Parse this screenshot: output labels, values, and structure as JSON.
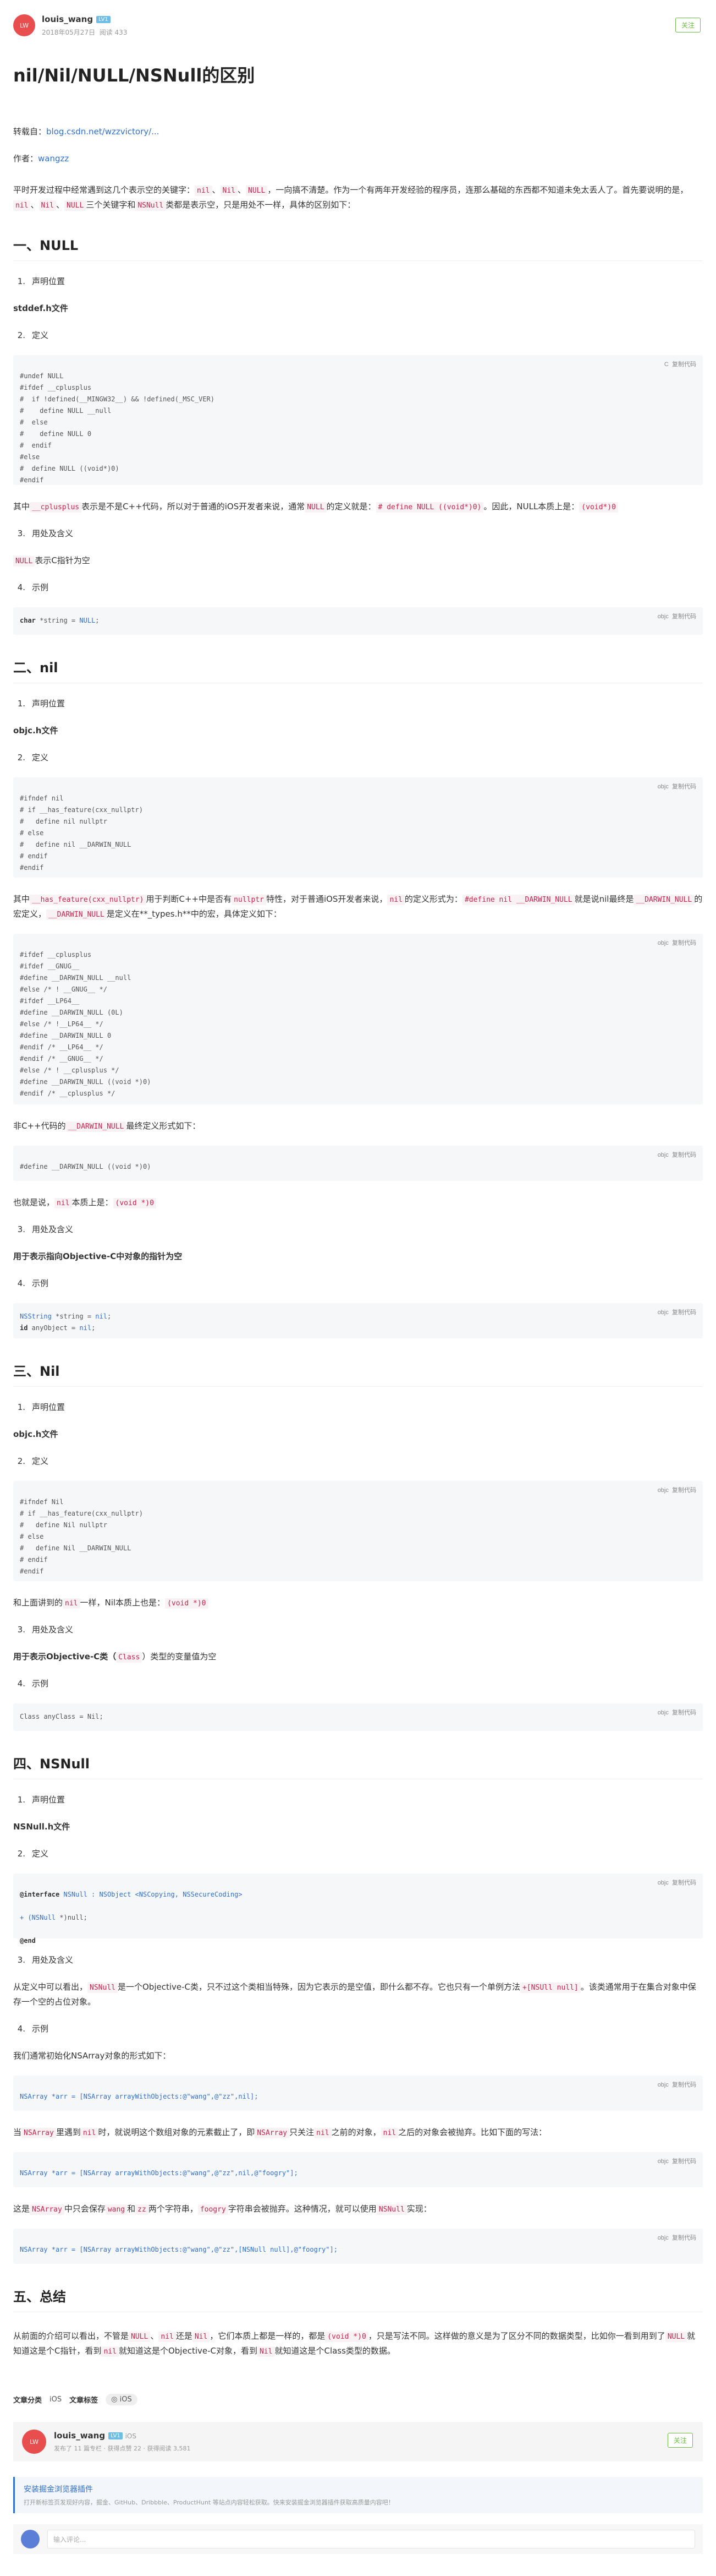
{
  "author": {
    "name": "louis_wang",
    "level": "LV1",
    "date": "2018年05月27日",
    "views": "阅读 433",
    "avatar_text": "LW",
    "follow_label": "关注"
  },
  "article": {
    "title": "nil/Nil/NULL/NSNull的区别",
    "reprint_label": "转载自：",
    "reprint_link": "blog.csdn.net/wzzvictory/...",
    "author_label": "作者：",
    "author_link": "wangzz",
    "intro_1": "平时开发过程中经常遇到这几个表示空的关键字：",
    "intro_kw": [
      "nil",
      "Nil",
      "NULL"
    ],
    "intro_2": "，一向搞不清楚。作为一个有两年开发经验的程序员，连那么基础的东西都不知道未免太丢人了。首先要说明的是，",
    "intro_kw2": [
      "nil",
      "Nil",
      "NULL"
    ],
    "intro_3": "三个关键字和",
    "intro_kw3": "NSNull",
    "intro_4": "类都是表示空，只是用处不一样，具体的区别如下："
  },
  "copy_label": "复制代码",
  "lang_c": "C",
  "lang_objc": "objc",
  "sections": {
    "null": {
      "heading": "一、NULL",
      "s1": "声明位置",
      "file": "stddef.h文件",
      "s2": "定义",
      "code": "#undef NULL\n#ifdef __cplusplus\n#  if !defined(__MINGW32__) && !defined(_MSC_VER)\n#    define NULL __null\n#  else\n#    define NULL 0\n#  endif\n#else\n#  define NULL ((void*)0)\n#endif",
      "p1a": "其中",
      "p1k1": "__cplusplus",
      "p1b": "表示是不是C++代码，所以对于普通的iOS开发者来说，通常",
      "p1k2": "NULL",
      "p1c": "的定义就是：",
      "p1k3": "# define NULL ((void*)0)",
      "p1d": "。因此，NULL本质上是：",
      "p1k4": "(void*)0",
      "s3": "用处及含义",
      "p2k": "NULL",
      "p2": "表示C指针为空",
      "s4": "示例",
      "ex_kw": "char",
      "ex_rest": " *string = ",
      "ex_val": "NULL",
      "ex_end": ";"
    },
    "nil": {
      "heading": "二、nil",
      "s1": "声明位置",
      "file": "objc.h文件",
      "s2": "定义",
      "code": "#ifndef nil\n# if __has_feature(cxx_nullptr)\n#   define nil nullptr\n# else\n#   define nil __DARWIN_NULL\n# endif\n#endif",
      "p1a": "其中",
      "p1k1": "__has_feature(cxx_nullptr)",
      "p1b": "用于判断C++中是否有",
      "p1k2": "nullptr",
      "p1c": "特性，对于普通iOS开发者来说，",
      "p1k3": "nil",
      "p1d": "的定义形式为：",
      "p1k4": "#define nil __DARWIN_NULL",
      "p1e": "就是说nil最终是",
      "p1k5": "__DARWIN_NULL",
      "p1f": "的宏定义，",
      "p1k6": "__DARWIN_NULL",
      "p1g": "是定义在**_types.h**中的宏，具体定义如下：",
      "code2": "#ifdef __cplusplus\n#ifdef __GNUG__\n#define __DARWIN_NULL __null\n#else /* ! __GNUG__ */\n#ifdef __LP64__\n#define __DARWIN_NULL (0L)\n#else /* !__LP64__ */\n#define __DARWIN_NULL 0\n#endif /* __LP64__ */\n#endif /* __GNUG__ */\n#else /* ! __cplusplus */\n#define __DARWIN_NULL ((void *)0)\n#endif /* __cplusplus */",
      "p2a": "非C++代码的",
      "p2k": "__DARWIN_NULL",
      "p2b": "最终定义形式如下：",
      "code3": "#define __DARWIN_NULL ((void *)0)",
      "p3a": "也就是说，",
      "p3k1": "nil",
      "p3b": "本质上是：",
      "p3k2": "(void *)0",
      "s3": "用处及含义",
      "p4": "用于表示指向Objective-C中对象的指针为空",
      "s4": "示例",
      "ex1_ty": "NSString",
      "ex1_rest": " *string = ",
      "ex1_val": "nil",
      "ex2_kw": "id",
      "ex2_rest": " anyObject = ",
      "ex2_val": "nil"
    },
    "Nil": {
      "heading": "三、Nil",
      "s1": "声明位置",
      "file": "objc.h文件",
      "s2": "定义",
      "code": "#ifndef Nil\n# if __has_feature(cxx_nullptr)\n#   define Nil nullptr\n# else\n#   define Nil __DARWIN_NULL\n# endif\n#endif",
      "p1a": "和上面讲到的",
      "p1k1": "nil",
      "p1b": "一样，Nil本质上也是：",
      "p1k2": "(void *)0",
      "s3": "用处及含义",
      "p2a": "用于表示Objective-C类（",
      "p2k": "Class",
      "p2b": "）类型的变量值为空",
      "s4": "示例",
      "ex": "Class anyClass = Nil;"
    },
    "nsnull": {
      "heading": "四、NSNull",
      "s1": "声明位置",
      "file": "NSNull.h文件",
      "s2": "定义",
      "code_l1a": "@interface",
      "code_l1b": " NSNull : NSObject <NSCopying, NSSecureCoding>",
      "code_l2a": "+ (NSNull",
      "code_l2b": " *)null;",
      "code_l3": "@end",
      "s3": "用处及含义",
      "p1a": "从定义中可以看出，",
      "p1k1": "NSNull",
      "p1b": "是一个Objective-C类，只不过这个类相当特殊，因为它表示的是空值，即什么都不存。它也只有一个单例方法",
      "p1k2": "+[NSUll null]",
      "p1c": "。该类通常用于在集合对象中保存一个空的占位对象。",
      "s4": "示例",
      "p2": "我们通常初始化NSArray对象的形式如下：",
      "ex1": "NSArray *arr = [NSArray arrayWithObjects:@\"wang\",@\"zz\",nil];",
      "p3a": "当",
      "p3k1": "NSArray",
      "p3b": "里遇到",
      "p3k2": "nil",
      "p3c": "时，就说明这个数组对象的元素截止了，即",
      "p3k3": "NSArray",
      "p3d": "只关注",
      "p3k4": "nil",
      "p3e": "之前的对象，",
      "p3k5": "nil",
      "p3f": "之后的对象会被抛弃。比如下面的写法：",
      "ex2": "NSArray *arr = [NSArray arrayWithObjects:@\"wang\",@\"zz\",nil,@\"foogry\"];",
      "p4a": "这是",
      "p4k1": "NSArray",
      "p4b": "中只会保存",
      "p4k2": "wang",
      "p4c": "和",
      "p4k3": "zz",
      "p4d": "两个字符串，",
      "p4k4": "foogry",
      "p4e": "字符串会被抛弃。这种情况，就可以使用",
      "p4k5": "NSNull",
      "p4f": "实现：",
      "ex3": "NSArray *arr = [NSArray arrayWithObjects:@\"wang\",@\"zz\",[NSNull null],@\"foogry\"];"
    },
    "summary": {
      "heading": "五、总结",
      "pa": "从前面的介绍可以看出，不管是",
      "k1": "NULL",
      "pb": "、",
      "k2": "nil",
      "pc": "还是",
      "k3": "Nil",
      "pd": "，它们本质上都是一样的，都是",
      "k4": "(void *)0",
      "pe": "，只是写法不同。这样做的意义是为了区分不同的数据类型，比如你一看到用到了",
      "k5": "NULL",
      "pf": "就知道这是个C指针，看到",
      "k6": "nil",
      "pg": "就知道这是个Objective-C对象，看到",
      "k7": "Nil",
      "ph": "就知道这是个Class类型的数据。"
    }
  },
  "footer": {
    "category_label": "文章分类",
    "category": "iOS",
    "tags_label": "文章标签",
    "tag": "iOS",
    "card_name": "louis_wang",
    "card_level": "LV1",
    "card_platform": "iOS",
    "card_stats": "发布了 11 篇专栏 · 获得点赞 22 · 获得阅读 3,581",
    "card_follow": "关注",
    "promo_title": "安装掘金浏览器插件",
    "promo_desc": "打开新标签页发现好内容，掘金、GitHub、Dribbble、ProductHunt 等站点内容轻松获取。快来安装掘金浏览器插件获取高质量内容吧！",
    "comment_placeholder": "输入评论..."
  }
}
